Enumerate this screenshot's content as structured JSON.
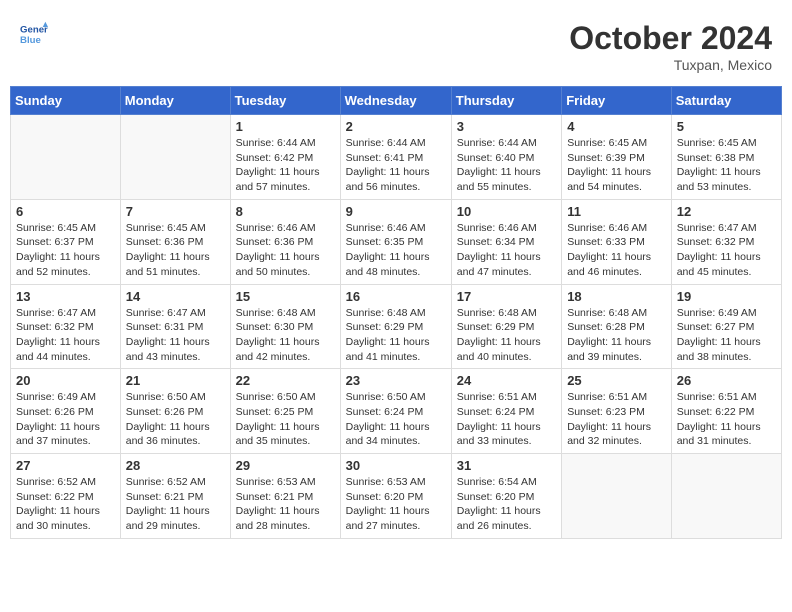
{
  "header": {
    "logo_general": "General",
    "logo_blue": "Blue",
    "month_title": "October 2024",
    "subtitle": "Tuxpan, Mexico"
  },
  "days_of_week": [
    "Sunday",
    "Monday",
    "Tuesday",
    "Wednesday",
    "Thursday",
    "Friday",
    "Saturday"
  ],
  "weeks": [
    [
      {
        "day": "",
        "info": ""
      },
      {
        "day": "",
        "info": ""
      },
      {
        "day": "1",
        "info": "Sunrise: 6:44 AM\nSunset: 6:42 PM\nDaylight: 11 hours and 57 minutes."
      },
      {
        "day": "2",
        "info": "Sunrise: 6:44 AM\nSunset: 6:41 PM\nDaylight: 11 hours and 56 minutes."
      },
      {
        "day": "3",
        "info": "Sunrise: 6:44 AM\nSunset: 6:40 PM\nDaylight: 11 hours and 55 minutes."
      },
      {
        "day": "4",
        "info": "Sunrise: 6:45 AM\nSunset: 6:39 PM\nDaylight: 11 hours and 54 minutes."
      },
      {
        "day": "5",
        "info": "Sunrise: 6:45 AM\nSunset: 6:38 PM\nDaylight: 11 hours and 53 minutes."
      }
    ],
    [
      {
        "day": "6",
        "info": "Sunrise: 6:45 AM\nSunset: 6:37 PM\nDaylight: 11 hours and 52 minutes."
      },
      {
        "day": "7",
        "info": "Sunrise: 6:45 AM\nSunset: 6:36 PM\nDaylight: 11 hours and 51 minutes."
      },
      {
        "day": "8",
        "info": "Sunrise: 6:46 AM\nSunset: 6:36 PM\nDaylight: 11 hours and 50 minutes."
      },
      {
        "day": "9",
        "info": "Sunrise: 6:46 AM\nSunset: 6:35 PM\nDaylight: 11 hours and 48 minutes."
      },
      {
        "day": "10",
        "info": "Sunrise: 6:46 AM\nSunset: 6:34 PM\nDaylight: 11 hours and 47 minutes."
      },
      {
        "day": "11",
        "info": "Sunrise: 6:46 AM\nSunset: 6:33 PM\nDaylight: 11 hours and 46 minutes."
      },
      {
        "day": "12",
        "info": "Sunrise: 6:47 AM\nSunset: 6:32 PM\nDaylight: 11 hours and 45 minutes."
      }
    ],
    [
      {
        "day": "13",
        "info": "Sunrise: 6:47 AM\nSunset: 6:32 PM\nDaylight: 11 hours and 44 minutes."
      },
      {
        "day": "14",
        "info": "Sunrise: 6:47 AM\nSunset: 6:31 PM\nDaylight: 11 hours and 43 minutes."
      },
      {
        "day": "15",
        "info": "Sunrise: 6:48 AM\nSunset: 6:30 PM\nDaylight: 11 hours and 42 minutes."
      },
      {
        "day": "16",
        "info": "Sunrise: 6:48 AM\nSunset: 6:29 PM\nDaylight: 11 hours and 41 minutes."
      },
      {
        "day": "17",
        "info": "Sunrise: 6:48 AM\nSunset: 6:29 PM\nDaylight: 11 hours and 40 minutes."
      },
      {
        "day": "18",
        "info": "Sunrise: 6:48 AM\nSunset: 6:28 PM\nDaylight: 11 hours and 39 minutes."
      },
      {
        "day": "19",
        "info": "Sunrise: 6:49 AM\nSunset: 6:27 PM\nDaylight: 11 hours and 38 minutes."
      }
    ],
    [
      {
        "day": "20",
        "info": "Sunrise: 6:49 AM\nSunset: 6:26 PM\nDaylight: 11 hours and 37 minutes."
      },
      {
        "day": "21",
        "info": "Sunrise: 6:50 AM\nSunset: 6:26 PM\nDaylight: 11 hours and 36 minutes."
      },
      {
        "day": "22",
        "info": "Sunrise: 6:50 AM\nSunset: 6:25 PM\nDaylight: 11 hours and 35 minutes."
      },
      {
        "day": "23",
        "info": "Sunrise: 6:50 AM\nSunset: 6:24 PM\nDaylight: 11 hours and 34 minutes."
      },
      {
        "day": "24",
        "info": "Sunrise: 6:51 AM\nSunset: 6:24 PM\nDaylight: 11 hours and 33 minutes."
      },
      {
        "day": "25",
        "info": "Sunrise: 6:51 AM\nSunset: 6:23 PM\nDaylight: 11 hours and 32 minutes."
      },
      {
        "day": "26",
        "info": "Sunrise: 6:51 AM\nSunset: 6:22 PM\nDaylight: 11 hours and 31 minutes."
      }
    ],
    [
      {
        "day": "27",
        "info": "Sunrise: 6:52 AM\nSunset: 6:22 PM\nDaylight: 11 hours and 30 minutes."
      },
      {
        "day": "28",
        "info": "Sunrise: 6:52 AM\nSunset: 6:21 PM\nDaylight: 11 hours and 29 minutes."
      },
      {
        "day": "29",
        "info": "Sunrise: 6:53 AM\nSunset: 6:21 PM\nDaylight: 11 hours and 28 minutes."
      },
      {
        "day": "30",
        "info": "Sunrise: 6:53 AM\nSunset: 6:20 PM\nDaylight: 11 hours and 27 minutes."
      },
      {
        "day": "31",
        "info": "Sunrise: 6:54 AM\nSunset: 6:20 PM\nDaylight: 11 hours and 26 minutes."
      },
      {
        "day": "",
        "info": ""
      },
      {
        "day": "",
        "info": ""
      }
    ]
  ]
}
